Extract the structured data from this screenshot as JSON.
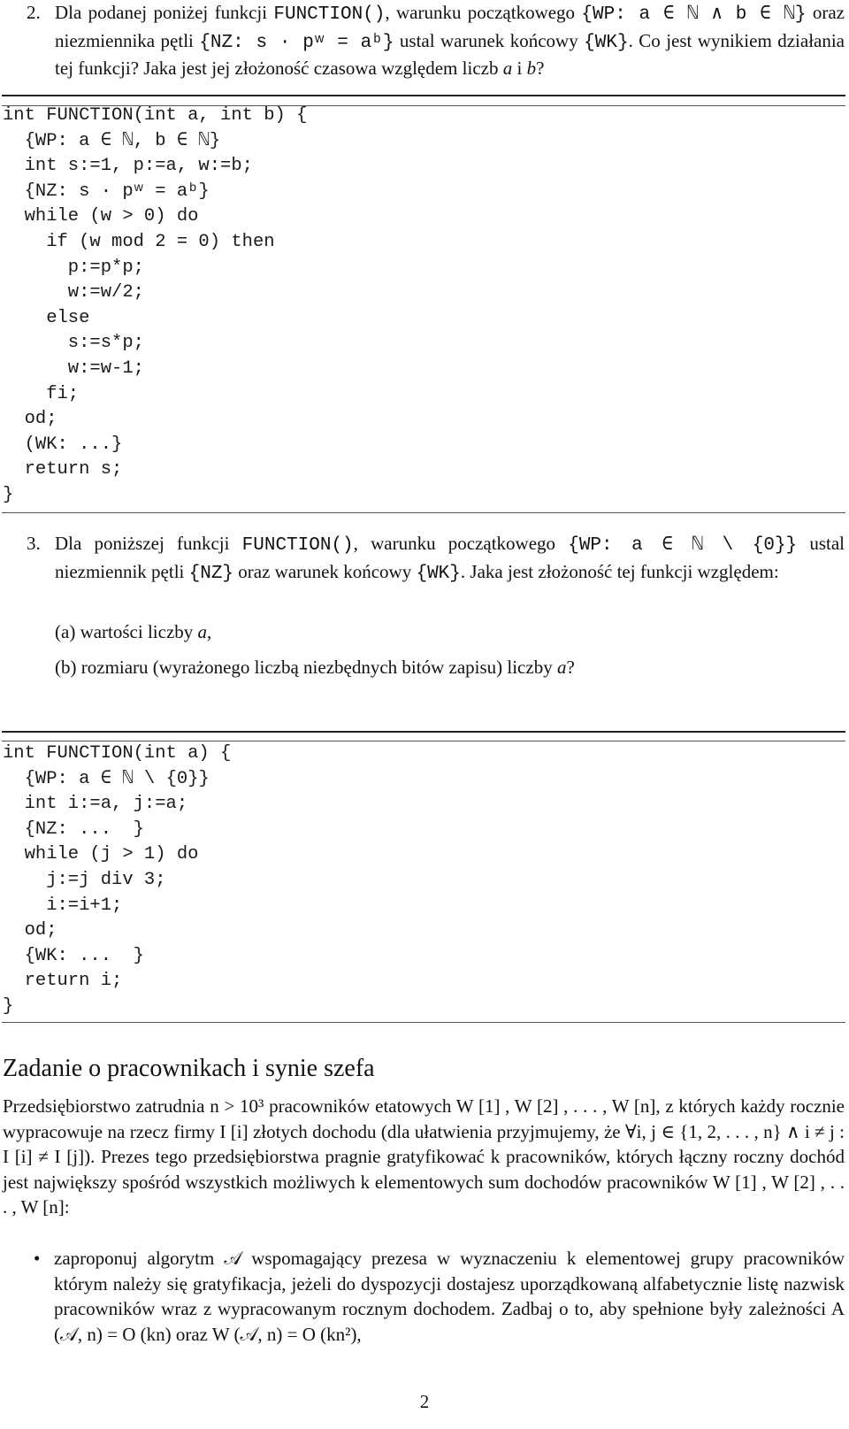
{
  "task2": {
    "number": "2.",
    "line1_a": "Dla podanej poniżej funkcji ",
    "func_name": "FUNCTION()",
    "line1_b": ", warunku początkowego ",
    "wp": "{WP: a ∈ ℕ ∧ b ∈ ℕ}",
    "line1_c": " oraz niezmiennika pętli ",
    "nz": "{NZ: s · pʷ = aᵇ}",
    "line1_d": " ustal warunek końcowy ",
    "wk": "{WK}",
    "line1_e": ". Co jest wynikiem działania tej funkcji? Jaka jest jej złożoność czasowa względem liczb ",
    "var_a": "a",
    "and": " i ",
    "var_b": "b",
    "end": "?"
  },
  "code1": {
    "lines": [
      "int FUNCTION(int a, int b) {",
      "  {WP: a ∈ ℕ, b ∈ ℕ}",
      "  int s:=1, p:=a, w:=b;",
      "  {NZ: s · pʷ = aᵇ}",
      "  while (w > 0) do",
      "    if (w mod 2 = 0) then",
      "      p:=p*p;",
      "      w:=w/2;",
      "    else",
      "      s:=s*p;",
      "      w:=w-1;",
      "    fi;",
      "  od;",
      "  (WK: ...}",
      "  return s;",
      "}"
    ]
  },
  "task3": {
    "number": "3.",
    "text_a": "Dla poniższej funkcji ",
    "func_name": "FUNCTION()",
    "text_b": ", warunku początkowego ",
    "wp": "{WP: a ∈ ℕ \\ {0}}",
    "text_c": " ustal niezmiennik pętli ",
    "nz": "{NZ}",
    "text_d": " oraz warunek końcowy ",
    "wk": "{WK}",
    "text_e": ". Jaka jest złożoność tej funkcji względem:",
    "sub": [
      {
        "label": "(a)",
        "text": "wartości liczby ",
        "var": "a",
        "end": ","
      },
      {
        "label": "(b)",
        "text": "rozmiaru (wyrażonego liczbą niezbędnych bitów zapisu) liczby ",
        "var": "a",
        "end": "?"
      }
    ]
  },
  "code2": {
    "lines": [
      "int FUNCTION(int a) {",
      "  {WP: a ∈ ℕ \\ {0}}",
      "  int i:=a, j:=a;",
      "  {NZ: ...  }",
      "  while (j > 1) do",
      "    j:=j div 3;",
      "    i:=i+1;",
      "  od;",
      "  {WK: ...  }",
      "  return i;",
      "}"
    ]
  },
  "section": {
    "title": "Zadanie o pracownikach i synie szefa",
    "paragraph": "Przedsiębiorstwo zatrudnia n > 10³ pracowników etatowych W [1] , W [2] , . . . , W [n], z których każdy rocznie wypracowuje na rzecz firmy I [i] złotych dochodu (dla ułatwienia przyjmujemy, że ∀i, j ∈ {1, 2, . . . , n} ∧ i ≠ j : I [i] ≠ I [j]). Prezes tego przedsiębiorstwa pragnie gratyfikować k pracowników, których łączny roczny dochód jest największy spośród wszystkich możliwych k elementowych sum dochodów pracowników W [1] , W [2] , . . . , W [n]:",
    "bullets": [
      "zaproponuj algorytm 𝒜 wspomagający prezesa w wyznaczeniu k elementowej grupy pracowników którym należy się gratyfikacja, jeżeli do dyspozycji dostajesz uporządkowaną alfabetycznie listę nazwisk pracowników wraz z wypracowanym rocznym dochodem. Zadbaj o to, aby spełnione były zależności A (𝒜, n) = O (kn) oraz W (𝒜, n) = O (kn²),"
    ]
  },
  "page_number": "2"
}
